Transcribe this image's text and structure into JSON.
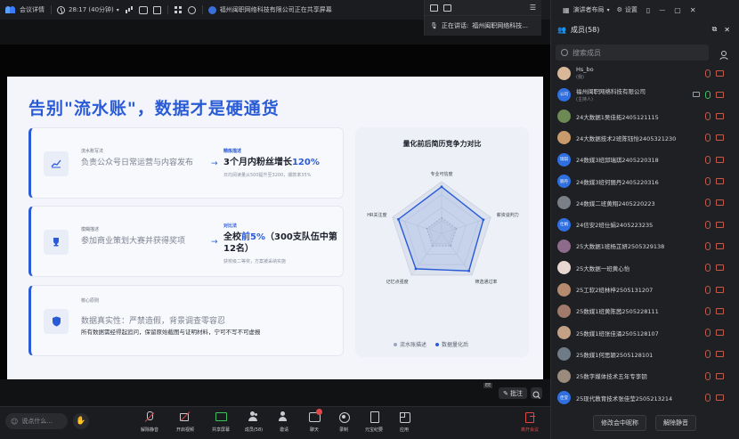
{
  "topbar": {
    "meeting_details": "会议详情",
    "timer": "28:17 (40分钟)",
    "sharing_status": "福州闽职网络科技有限公司正在共享屏幕"
  },
  "speaker": {
    "label": "正在讲话:",
    "name": "福州闽职网络科技..."
  },
  "slide": {
    "title": "告别\"流水账\"，数据才是硬通货",
    "cards": [
      {
        "tag": "流水账写法",
        "text": "负责公众号日常运营与内容发布",
        "arrow": "→",
        "result_tag": "精炼描述",
        "result_pre": "3个月内粉丝增长",
        "result_hl": "120%",
        "result_post": "",
        "result_sub": "日均阅读量从500提升至3200，爆款率35%",
        "icon": "chart-line-icon"
      },
      {
        "tag": "模糊描述",
        "text": "参加商业策划大赛并获得奖项",
        "arrow": "→",
        "result_tag": "对比法",
        "result_pre": "全校",
        "result_hl": "前5%",
        "result_post": "（300支队伍中第12名）",
        "result_sub": "获校级二等奖，方案被采纳实施",
        "icon": "trophy-icon"
      },
      {
        "tag": "核心原则",
        "text": "数据真实性：严禁造假，背景调查零容忍",
        "sub": "所有数据需经得起追问，保留原始截图与证明材料，宁可不写不可虚报",
        "icon": "shield-icon"
      }
    ],
    "annotate_label": "批注",
    "watermark": "EE"
  },
  "chart_data": {
    "type": "radar",
    "title": "量化前后简历竞争力对比",
    "axes": [
      "专业可信度",
      "薪资谈判力",
      "筛选通过率",
      "记忆点强度",
      "HR关注度"
    ],
    "series": [
      {
        "name": "流水账描述",
        "values": [
          30,
          30,
          30,
          30,
          30
        ],
        "color": "#9aa6c0"
      },
      {
        "name": "数据量化后",
        "values": [
          90,
          85,
          90,
          85,
          88
        ],
        "color": "#2a5bd7"
      }
    ],
    "range": [
      0,
      100
    ]
  },
  "toolbar": {
    "chat_placeholder": "说点什么...",
    "buttons": [
      {
        "label": "解除静音",
        "icon": "mic-muted-icon"
      },
      {
        "label": "开启视频",
        "icon": "camera-off-icon"
      },
      {
        "label": "共享屏幕",
        "icon": "screen-share-icon"
      },
      {
        "label": "成员(58)",
        "icon": "members-icon"
      },
      {
        "label": "邀请",
        "icon": "invite-icon"
      },
      {
        "label": "聊天",
        "icon": "chat-icon"
      },
      {
        "label": "录制",
        "icon": "record-icon"
      },
      {
        "label": "元宝纪要",
        "icon": "notes-icon"
      },
      {
        "label": "应用",
        "icon": "apps-icon"
      }
    ],
    "leave": "离开会议"
  },
  "rpanel": {
    "top": {
      "presenter_layout": "演讲者布局",
      "settings": "设置"
    },
    "header": "成员(58)",
    "search_placeholder": "搜索成员",
    "members": [
      {
        "name": "Hs_bo",
        "sub": "(我)",
        "avatar_text": "",
        "avatar_color": "#d9b89a"
      },
      {
        "name": "福州闽职网络科技有限公司",
        "sub": "(主持人)",
        "avatar_text": "公司",
        "avatar_color": "#2f6fe0"
      },
      {
        "name": "24大数据1吴佳拓2405121115",
        "avatar_text": "",
        "avatar_color": "#6d8a55"
      },
      {
        "name": "24大数据技术2班陈钰怡2405321230",
        "avatar_text": "",
        "avatar_color": "#c99a6b"
      },
      {
        "name": "24数媒3班邱瑞琪2405220318",
        "avatar_text": "瑞琪",
        "avatar_color": "#2f6fe0"
      },
      {
        "name": "24数媒3班何丽丹2405220316",
        "avatar_text": "丽丹",
        "avatar_color": "#2f6fe0"
      },
      {
        "name": "24数媒二班黄翔2405220223",
        "avatar_text": "",
        "avatar_color": "#7a7f88"
      },
      {
        "name": "24信安2班仕娟2405223235",
        "avatar_text": "仕娟",
        "avatar_color": "#2f6fe0"
      },
      {
        "name": "25大数据1班杨芷妍2505329138",
        "avatar_text": "",
        "avatar_color": "#8e6b8a"
      },
      {
        "name": "25大数据一班黄心怡",
        "avatar_text": "",
        "avatar_color": "#e8d6d0"
      },
      {
        "name": "25工软2班林梓2505131207",
        "avatar_text": "",
        "avatar_color": "#b58a6e"
      },
      {
        "name": "25数媒1班黄陈茜2505228111",
        "avatar_text": "",
        "avatar_color": "#a07a6a"
      },
      {
        "name": "25数媒1班张佳涌2505128107",
        "avatar_text": "",
        "avatar_color": "#c2a184"
      },
      {
        "name": "25数媒1何思颖2505128101",
        "avatar_text": "",
        "avatar_color": "#6f7b86"
      },
      {
        "name": "25数字媒体技术五年专李钥",
        "avatar_text": "",
        "avatar_color": "#9b8b7c"
      },
      {
        "name": "25现代教育技术张佳莹2505213214",
        "avatar_text": "佳莹",
        "avatar_color": "#2f6fe0"
      }
    ],
    "btn_rename": "修改会中昵称",
    "btn_unmute": "解除静音"
  }
}
